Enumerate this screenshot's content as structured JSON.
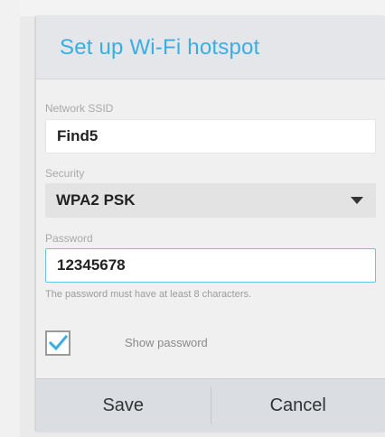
{
  "dialog": {
    "title": "Set up Wi-Fi hotspot",
    "ssid": {
      "label": "Network SSID",
      "value": "Find5"
    },
    "security": {
      "label": "Security",
      "selected": "WPA2 PSK"
    },
    "password": {
      "label": "Password",
      "value": "12345678",
      "hint": "The password must have at least 8 characters."
    },
    "show_password": {
      "label": "Show password",
      "checked": true
    },
    "buttons": {
      "save": "Save",
      "cancel": "Cancel"
    }
  },
  "colors": {
    "accent": "#3aaee0",
    "focus_border": "#6cc3e6",
    "header_bg": "#e4e6ea",
    "dialog_bg": "#f0f0f0",
    "button_bar_bg": "#dadde1"
  },
  "icons": {
    "checkmark": "check-icon",
    "dropdown": "chevron-down-icon"
  }
}
